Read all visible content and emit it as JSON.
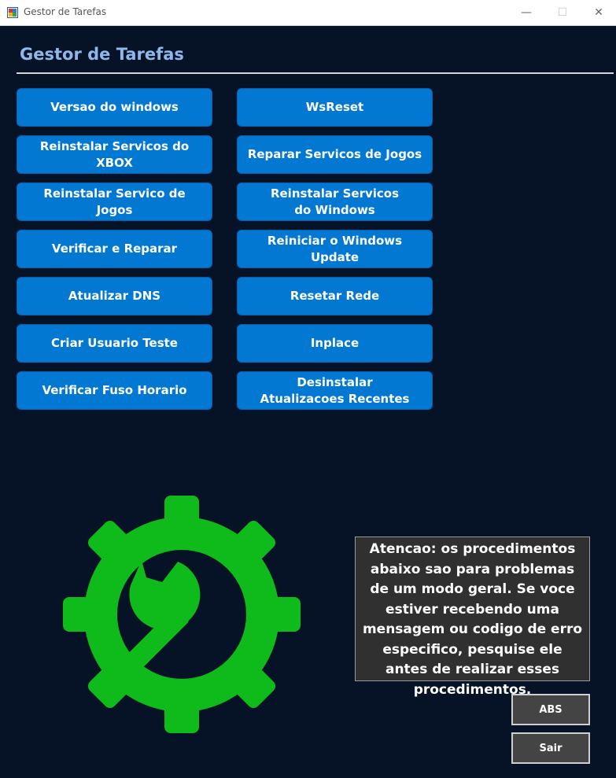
{
  "window": {
    "title": "Gestor de Tarefas",
    "controls": {
      "minimize": "—",
      "maximize": "☐",
      "close": "✕"
    }
  },
  "header": {
    "title": "Gestor de Tarefas"
  },
  "buttons": {
    "left": [
      "Versao do windows",
      "Reinstalar Servicos do XBOX",
      "Reinstalar Servico de Jogos",
      "Verificar e Reparar",
      "Atualizar DNS",
      "Criar Usuario Teste",
      "Verificar Fuso Horario"
    ],
    "right": [
      "WsReset",
      "Reparar Servicos de Jogos",
      "Reinstalar Servicos do Windows",
      "Reiniciar o Windows Update",
      "Resetar Rede",
      "Inplace",
      "Desinstalar Atualizacoes Recentes"
    ]
  },
  "notice": {
    "text": "Atencao: os procedimentos abaixo sao para problemas de um modo geral. Se voce estiver recebendo uma mensagem ou codigo de erro especifico, pesquise ele antes de realizar esses procedimentos."
  },
  "side_buttons": {
    "abs": "ABS",
    "exit": "Sair"
  },
  "icons": {
    "main": "gear-wrench-icon"
  },
  "colors": {
    "background": "#061326",
    "button": "#0278d2",
    "header": "#8fb7ea",
    "gear": "#0fba1b",
    "notice_bg": "#303030",
    "side_button": "#444444"
  }
}
